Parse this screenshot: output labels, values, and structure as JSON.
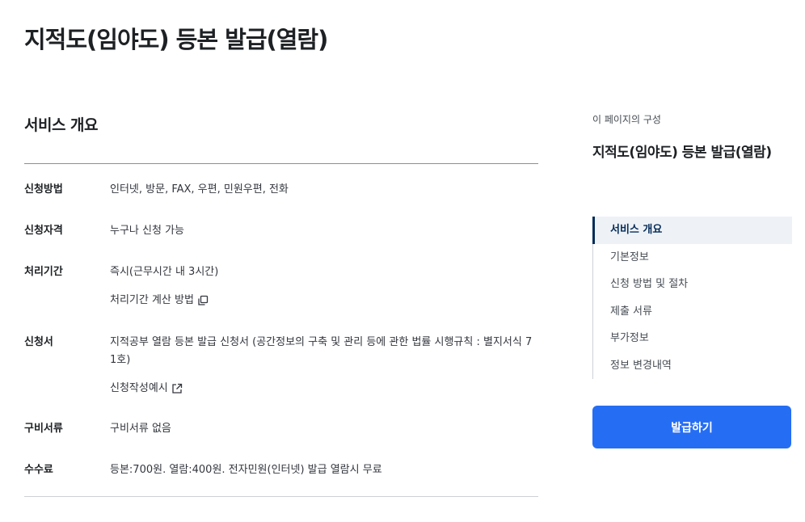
{
  "page": {
    "title": "지적도(임야도) 등본 발급(열람)"
  },
  "overview": {
    "heading": "서비스 개요",
    "rows": [
      {
        "label": "신청방법",
        "value": "인터넷, 방문, FAX, 우편, 민원우편, 전화"
      },
      {
        "label": "신청자격",
        "value": "누구나 신청 가능"
      },
      {
        "label": "처리기간",
        "value": "즉시(근무시간 내 3시간)",
        "link": "처리기간 계산 방법"
      },
      {
        "label": "신청서",
        "value1": "지적공부 열람 등본 발급 신청서 (공간정보의 구축 및 관리 등에 관한 법률 시행규칙 : 별지서식 7",
        "value2": "1호)",
        "link": "신청작성예시"
      },
      {
        "label": "구비서류",
        "value": "구비서류 없음"
      },
      {
        "label": "수수료",
        "value": "등본:700원. 열람:400원. 전자민원(인터넷) 발급 열람시 무료"
      }
    ]
  },
  "aside": {
    "caption": "이 페이지의 구성",
    "title": "지적도(임야도) 등본 발급(열람)",
    "toc": [
      "서비스 개요",
      "기본정보",
      "신청 방법 및 절차",
      "제출 서류",
      "부가정보",
      "정보 변경내역"
    ],
    "issue_button": "발급하기"
  },
  "colors": {
    "primary": "#256ef4",
    "active_nav": "#052b57",
    "active_nav_bg": "#eef2f7"
  },
  "icons": {
    "copy": "copy-icon",
    "external": "external-link-icon"
  }
}
